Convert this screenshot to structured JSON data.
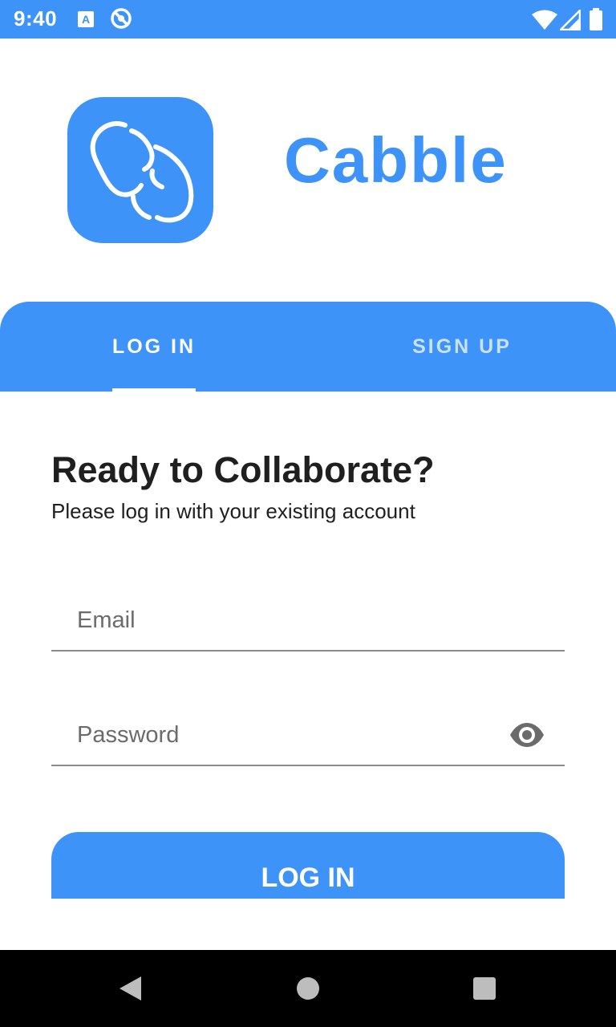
{
  "status_bar": {
    "time": "9:40",
    "icons": [
      "text-a-icon",
      "no-disturb-icon",
      "wifi-icon",
      "signal-icon",
      "battery-icon"
    ],
    "background": "#3d93f8"
  },
  "branding": {
    "app_name": "Cabble",
    "logo_icon": "chain-link-icon",
    "accent_color": "#3d93f8"
  },
  "tabs": [
    {
      "label": "LOG IN",
      "selected": true
    },
    {
      "label": "SIGN UP",
      "selected": false
    }
  ],
  "content": {
    "title": "Ready to Collaborate?",
    "subtitle": "Please log in with your existing account"
  },
  "form": {
    "email": {
      "placeholder": "Email",
      "value": ""
    },
    "password": {
      "placeholder": "Password",
      "value": "",
      "toggle_icon": "eye-icon"
    },
    "submit_label": "LOG IN"
  },
  "nav_bar": {
    "icons": [
      "back-icon",
      "home-icon",
      "recents-icon"
    ]
  }
}
